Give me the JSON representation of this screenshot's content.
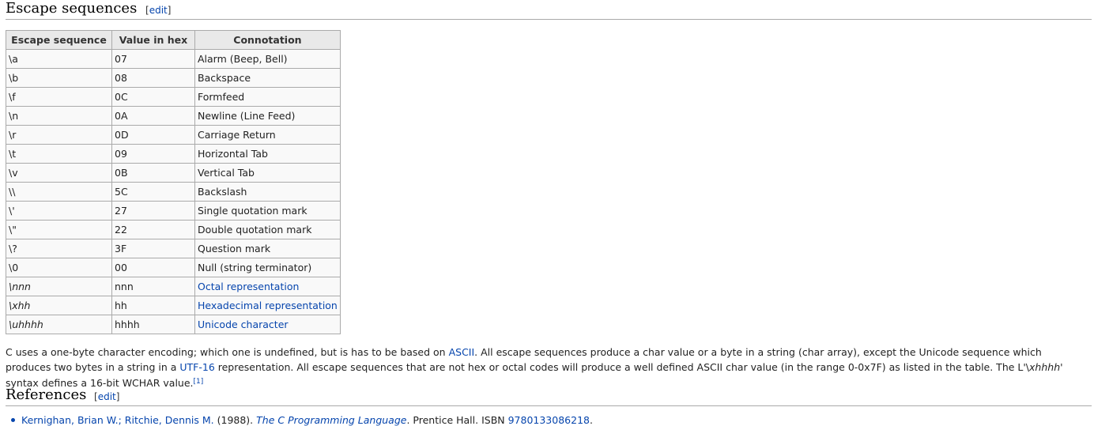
{
  "section_escape": {
    "title": "Escape sequences",
    "edit_label": "edit"
  },
  "table": {
    "headers": [
      "Escape sequence",
      "Value in hex",
      "Connotation"
    ],
    "rows": [
      {
        "seq": "\\a",
        "hex": "07",
        "meaning": "Alarm (Beep, Bell)"
      },
      {
        "seq": "\\b",
        "hex": "08",
        "meaning": "Backspace"
      },
      {
        "seq": "\\f",
        "hex": "0C",
        "meaning": "Formfeed"
      },
      {
        "seq": "\\n",
        "hex": "0A",
        "meaning": "Newline (Line Feed)"
      },
      {
        "seq": "\\r",
        "hex": "0D",
        "meaning": "Carriage Return"
      },
      {
        "seq": "\\t",
        "hex": "09",
        "meaning": "Horizontal Tab"
      },
      {
        "seq": "\\v",
        "hex": "0B",
        "meaning": "Vertical Tab"
      },
      {
        "seq": "\\\\",
        "hex": "5C",
        "meaning": "Backslash"
      },
      {
        "seq": "\\'",
        "hex": "27",
        "meaning": "Single quotation mark"
      },
      {
        "seq": "\\\"",
        "hex": "22",
        "meaning": "Double quotation mark"
      },
      {
        "seq": "\\?",
        "hex": "3F",
        "meaning": "Question mark"
      },
      {
        "seq": "\\0",
        "hex": "00",
        "meaning": "Null (string terminator)"
      },
      {
        "seq": "\\nnn",
        "hex": "nnn",
        "meaning": "Octal representation"
      },
      {
        "seq": "\\xhh",
        "hex": "hh",
        "meaning": "Hexadecimal representation"
      },
      {
        "seq": "\\uhhhh",
        "hex": "hhhh",
        "meaning": "Unicode character"
      }
    ]
  },
  "paragraph": {
    "p1": "C uses a one-byte character encoding; which one is undefined, but is has to be based on ",
    "ascii_link": "ASCII",
    "p2": ". All escape sequences produce a char value or a byte in a string (char array), except the Unicode sequence which produces two bytes in a string in a ",
    "utf16_link": "UTF-16",
    "p3": " representation. All escape sequences that are not hex or octal codes will produce a well defined ASCII char value (in the range 0-0x7F) as listed in the table. The L'\\",
    "p3_italic": "xhhhh",
    "p4": "' syntax defines a 16-bit WCHAR value.",
    "footnote": "[1]"
  },
  "section_refs": {
    "title": "References",
    "edit_label": "edit"
  },
  "references": {
    "authors": "Kernighan, Brian W.; Ritchie, Dennis M.",
    "year_text": " (1988). ",
    "book_title": "The C Programming Language",
    "publisher_text": ". Prentice Hall. ISBN ",
    "isbn": "9780133086218",
    "end": "."
  }
}
